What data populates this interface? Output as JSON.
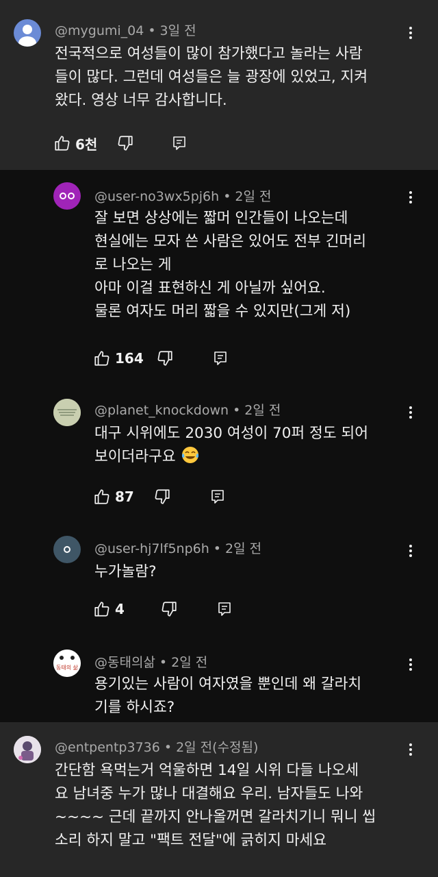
{
  "comments": [
    {
      "handle": "@mygumi_04",
      "time": "3일 전",
      "body": "전국적으로 여성들이 많이 참가했다고 놀라는 사람\n들이 많다. 그런데 여성들은 늘 광장에 있었고, 지켜\n왔다. 영상 너무 감사합니다.",
      "likes": "6천",
      "avatar_icon": "person-icon",
      "avatar_color": "#6b8bd6"
    },
    {
      "handle": "@user-no3wx5pj6h",
      "time": "2일 전",
      "body": "잘 보면 상상에는 짧머 인간들이 나오는데\n현실에는 모자 쓴 사람은 있어도 전부 긴머리\n로 나오는 게\n아마 이걸 표현하신 게 아닐까 싶어요.\n물론 여자도 머리 짧을 수 있지만(그게 저)",
      "likes": "164",
      "avatar_icon": "face-icon",
      "avatar_color": "#a024b8"
    },
    {
      "handle": "@planet_knockdown",
      "time": "2일 전",
      "body_line1": "대구 시위에도 2030 여성이 70퍼 정도 되어",
      "body_line2": "보이더라구요",
      "emoji": "tears-of-joy-emoji",
      "likes": "87",
      "avatar_icon": "photo-icon",
      "avatar_color": "#c9cfb0"
    },
    {
      "handle": "@user-hj7lf5np6h",
      "time": "2일 전",
      "body": "누가놀람?",
      "likes": "4",
      "avatar_icon": "face-icon",
      "avatar_color": "#3f5666"
    },
    {
      "handle": "@동태의삶",
      "time": "2일 전",
      "body": "용기있는 사람이 여자였을 뿐인데 왜 갈라치\n기를 하시죠?",
      "avatar_icon": "drawing-icon",
      "avatar_text": "동태의 삶",
      "avatar_color": "#ffffff"
    },
    {
      "handle": "@entpentp3736",
      "time": "2일 전(수정됨)",
      "body": "간단함 욕먹는거 억울하면 14일 시위 다들 나오세\n요 남녀중 누가 많나 대결해요 우리. 남자들도 나와\n~~~~ 근데 끝까지 안나올꺼면 갈라치기니 뭐니 씹\n소리 하지 말고 \"팩트 전달\"에 긁히지 마세요",
      "avatar_icon": "cartoon-icon",
      "avatar_color": "#e8e2ea"
    }
  ],
  "colors": {
    "top_level_bg": "#272727",
    "reply_bg": "#0f0f0f",
    "meta": "#aaaaaa",
    "text": "#f1f1f1"
  }
}
